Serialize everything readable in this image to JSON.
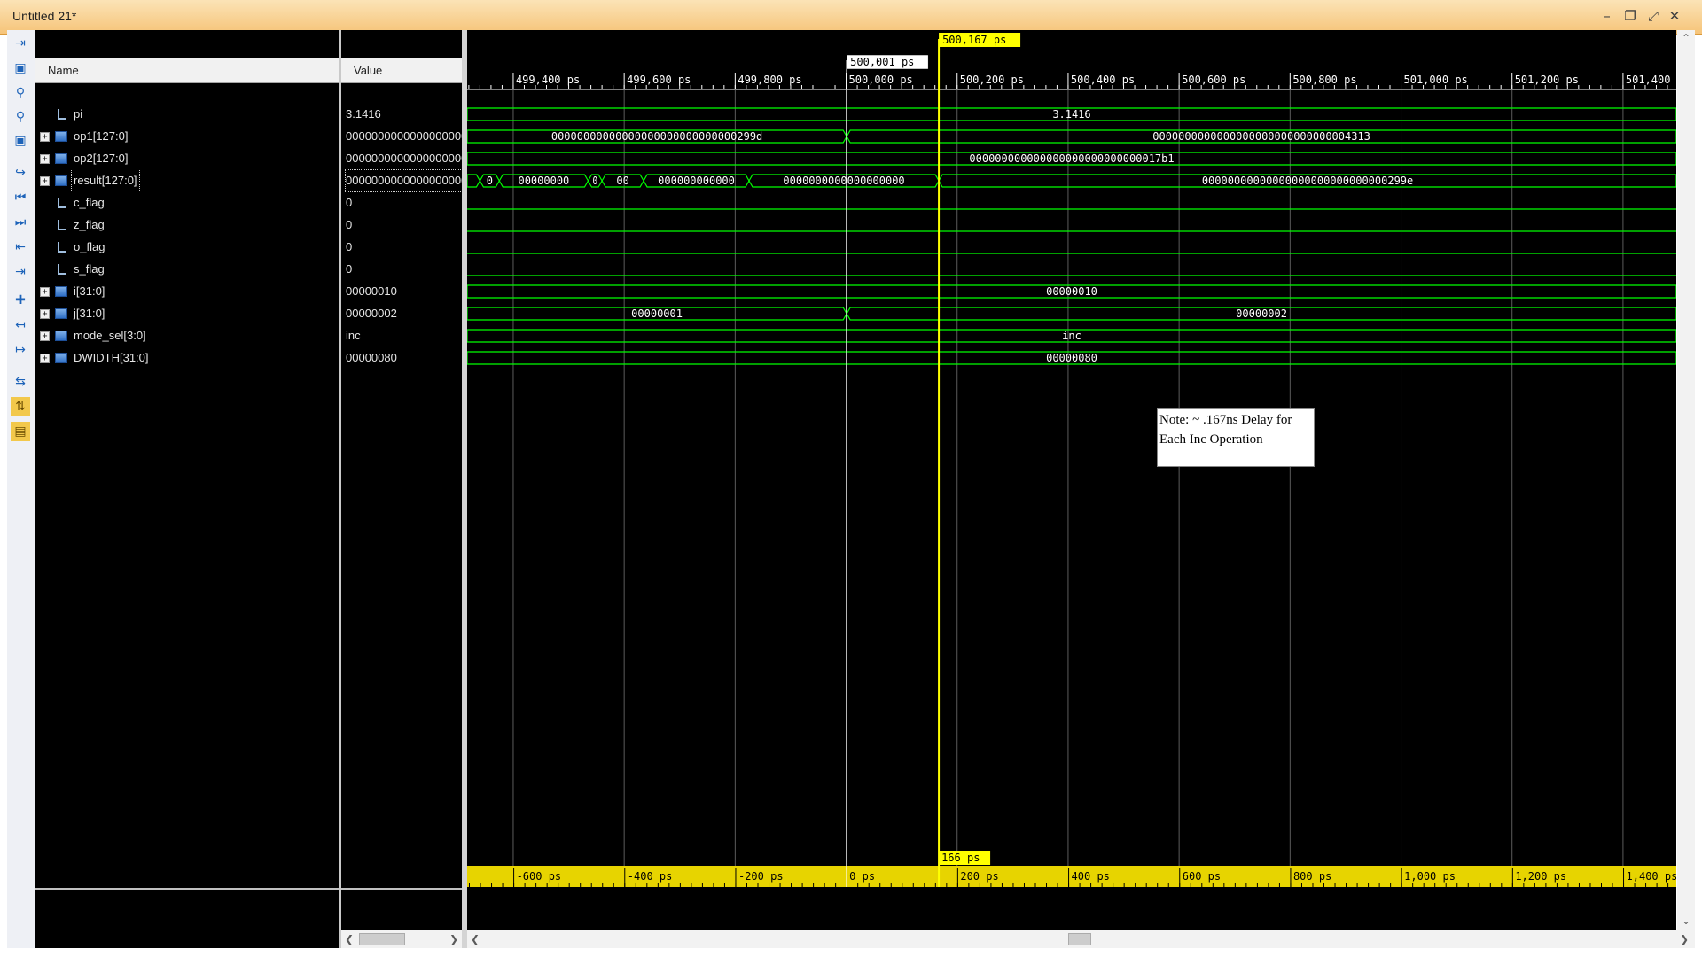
{
  "window": {
    "title": "Untitled 21*",
    "controls": [
      "minimize-icon",
      "restore-icon",
      "maximize-icon",
      "close-icon"
    ]
  },
  "toolbar": {
    "tools": [
      "zoom-fit-icon",
      "save-icon",
      "zoom-in-icon",
      "zoom-out-icon",
      "zoom-full-icon",
      "goto-cursor-icon",
      "go-to-start-icon",
      "go-to-end-icon",
      "previous-transition-icon",
      "next-transition-icon",
      "add-marker-icon",
      "previous-marker-icon",
      "next-marker-icon",
      "swap-cursors-icon",
      "snap-to-transition-icon",
      "floating-ruler-icon"
    ]
  },
  "headers": {
    "name": "Name",
    "value": "Value"
  },
  "signals": [
    {
      "name": "pi",
      "value": "3.1416",
      "type": "bit",
      "expandable": false
    },
    {
      "name": "op1[127:0]",
      "value": "00000000000000000000",
      "type": "bus",
      "expandable": true
    },
    {
      "name": "op2[127:0]",
      "value": "00000000000000000000",
      "type": "bus",
      "expandable": true
    },
    {
      "name": "result[127:0]",
      "value": "00000000000000000000",
      "type": "bus",
      "expandable": true,
      "selected": true
    },
    {
      "name": "c_flag",
      "value": "0",
      "type": "bit",
      "expandable": false
    },
    {
      "name": "z_flag",
      "value": "0",
      "type": "bit",
      "expandable": false
    },
    {
      "name": "o_flag",
      "value": "0",
      "type": "bit",
      "expandable": false
    },
    {
      "name": "s_flag",
      "value": "0",
      "type": "bit",
      "expandable": false
    },
    {
      "name": "i[31:0]",
      "value": "00000010",
      "type": "bus",
      "expandable": true
    },
    {
      "name": "j[31:0]",
      "value": "00000002",
      "type": "bus",
      "expandable": true
    },
    {
      "name": "mode_sel[3:0]",
      "value": "inc",
      "type": "bus",
      "expandable": true
    },
    {
      "name": "DWIDTH[31:0]",
      "value": "00000080",
      "type": "bus",
      "expandable": true
    }
  ],
  "timeline": {
    "ticks": [
      "499,400 ps",
      "499,600 ps",
      "499,800 ps",
      "500,000 ps",
      "500,200 ps",
      "500,400 ps",
      "500,600 ps",
      "500,800 ps",
      "501,000 ps",
      "501,200 ps",
      "501,400"
    ],
    "tick_times_ps": [
      499400,
      499600,
      499800,
      500000,
      500200,
      500400,
      500600,
      500800,
      501000,
      501200,
      501400
    ],
    "view_start_ps": 499317,
    "view_end_ps": 501496
  },
  "cursors": {
    "main": {
      "label": "500,167 ps",
      "time_ps": 500167,
      "color": "#ffff00"
    },
    "secondary": {
      "label": "500,001 ps",
      "time_ps": 500001,
      "color": "#ffffff"
    },
    "delta_label": "166 ps"
  },
  "relative_ruler": {
    "ticks": [
      "-600 ps",
      "-400 ps",
      "-200 ps",
      "0 ps",
      "200 ps",
      "400 ps",
      "600 ps",
      "800 ps",
      "1,000 ps",
      "1,200 ps",
      "1,400 ps"
    ],
    "tick_offsets_ps": [
      -600,
      -400,
      -200,
      0,
      200,
      400,
      600,
      800,
      1000,
      1200,
      1400
    ],
    "color": "#e7d400"
  },
  "waves": [
    {
      "kind": "bus",
      "segments": [
        {
          "start": 499317,
          "end": 501496,
          "label": "3.1416"
        }
      ]
    },
    {
      "kind": "bus",
      "segments": [
        {
          "start": 499317,
          "end": 500001,
          "label": "00000000000000000000000000000299d"
        },
        {
          "start": 500001,
          "end": 501496,
          "label": "0000000000000000000000000000004313"
        }
      ]
    },
    {
      "kind": "bus",
      "segments": [
        {
          "start": 499317,
          "end": 501496,
          "label": "000000000000000000000000000017b1"
        }
      ]
    },
    {
      "kind": "bus",
      "segments": [
        {
          "start": 499317,
          "end": 499340,
          "label": ""
        },
        {
          "start": 499340,
          "end": 499375,
          "label": "0"
        },
        {
          "start": 499375,
          "end": 499535,
          "label": "00000000"
        },
        {
          "start": 499535,
          "end": 499560,
          "label": "0"
        },
        {
          "start": 499560,
          "end": 499635,
          "label": "00"
        },
        {
          "start": 499635,
          "end": 499825,
          "label": "000000000000"
        },
        {
          "start": 499825,
          "end": 500167,
          "label": "0000000000000000000"
        },
        {
          "start": 500167,
          "end": 501496,
          "label": "00000000000000000000000000000299e"
        }
      ]
    },
    {
      "kind": "bit",
      "level": 0
    },
    {
      "kind": "bit",
      "level": 0
    },
    {
      "kind": "bit",
      "level": 0
    },
    {
      "kind": "bit",
      "level": 0
    },
    {
      "kind": "bus",
      "segments": [
        {
          "start": 499317,
          "end": 501496,
          "label": "00000010"
        }
      ]
    },
    {
      "kind": "bus",
      "segments": [
        {
          "start": 499317,
          "end": 500001,
          "label": "00000001"
        },
        {
          "start": 500001,
          "end": 501496,
          "label": "00000002"
        }
      ]
    },
    {
      "kind": "bus",
      "segments": [
        {
          "start": 499317,
          "end": 501496,
          "label": "inc"
        }
      ]
    },
    {
      "kind": "bus",
      "segments": [
        {
          "start": 499317,
          "end": 501496,
          "label": "00000080"
        }
      ]
    }
  ],
  "note": {
    "line1": "Note: ~ .167ns Delay for",
    "line2": "Each Inc Operation"
  },
  "colors": {
    "wave": "#00ff00",
    "wave_text": "#ffffff",
    "grid": "#5c5c5c",
    "background": "#000000"
  }
}
